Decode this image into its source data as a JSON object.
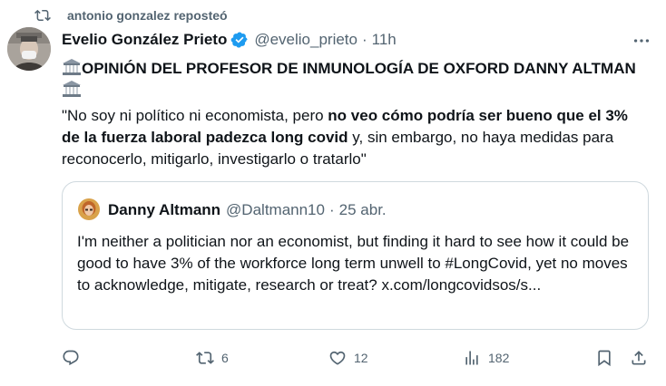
{
  "repost": {
    "label": "antonio gonzalez reposteó"
  },
  "author": {
    "name": "Evelio González Prieto",
    "handle": "@evelio_prieto",
    "separator": "·",
    "time": "11h"
  },
  "tweet": {
    "title": "OPINIÓN DEL PROFESOR DE INMUNOLOGÍA DE OXFORD DANNY ALTMAN",
    "body_part1": "\"No soy ni político ni economista, pero ",
    "body_bold": "no veo cómo podría ser bueno que el 3% de la fuerza laboral padezca long covid",
    "body_part2": " y, sin embargo, no haya medidas para reconocerlo, mitigarlo, investigarlo o tratarlo\""
  },
  "quote": {
    "name": "Danny Altmann",
    "handle": "@Daltmann10",
    "separator": "·",
    "time": "25 abr.",
    "text": "I'm neither a politician nor an economist, but finding it hard to see how it could be good to have 3% of the workforce long term unwell to #LongCovid, yet no moves to acknowledge, mitigate, research or treat? x.com/longcovidsos/s..."
  },
  "actions": {
    "replies": "",
    "reposts": "6",
    "likes": "12",
    "views": "182"
  },
  "colors": {
    "text": "#0f1419",
    "secondary": "#536471",
    "verified": "#1d9bf0",
    "border": "#cfd9de",
    "repost_active": "#536471"
  },
  "icons": {
    "repost": "repost-icon",
    "verified": "verified-badge-icon",
    "more": "more-icon",
    "classical_building": "classical-building-emoji",
    "reply": "reply-icon",
    "like": "heart-icon",
    "views": "views-icon",
    "bookmark": "bookmark-icon",
    "share": "share-icon"
  }
}
